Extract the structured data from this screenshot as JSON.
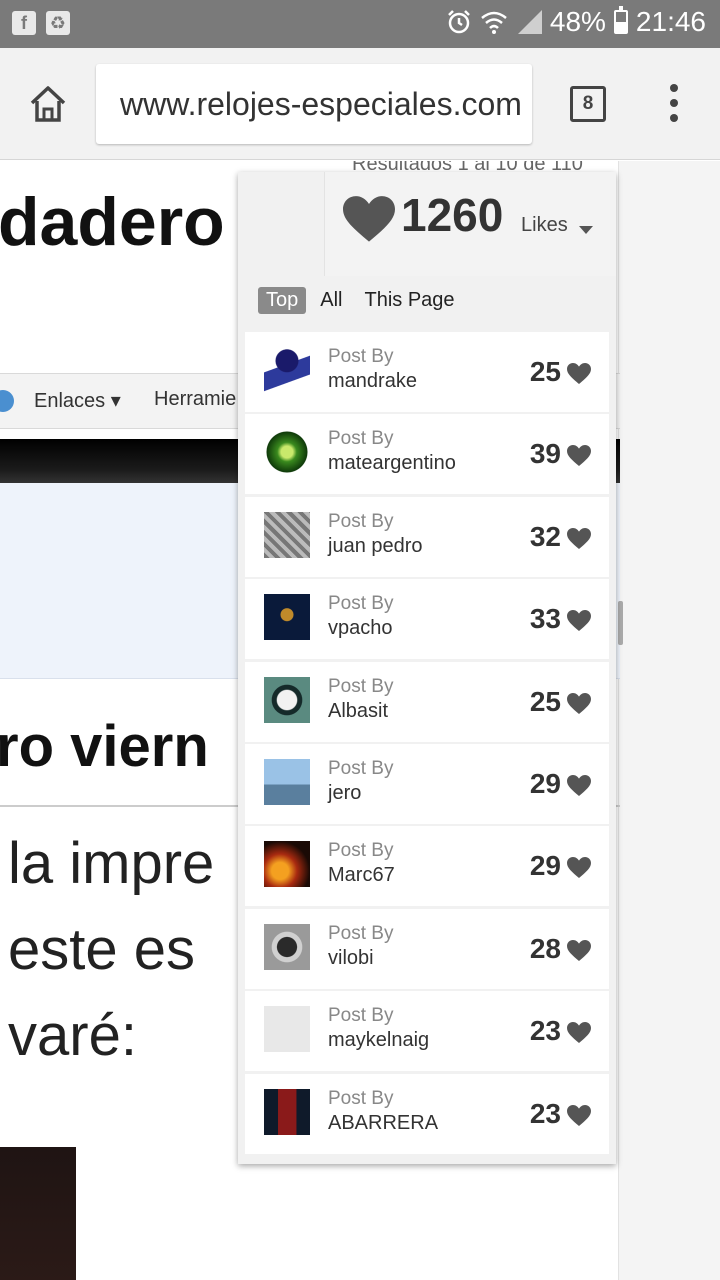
{
  "status_bar": {
    "battery": "48%",
    "battery_level": 0.48,
    "time": "21:46",
    "icons": [
      "facebook-icon",
      "recycle-icon",
      "alarm-icon",
      "wifi-icon",
      "signal-icon",
      "battery-icon"
    ]
  },
  "browser": {
    "url": "www.relojes-especiales.com",
    "tab_count": "8"
  },
  "page": {
    "results_text": "Resultados 1 al 10 de 110",
    "headline_fragment": "dadero",
    "nav_items": [
      "Enlaces",
      "Herramie"
    ],
    "headline2_fragment": "ro viern",
    "body_lines": [
      "la impre",
      "este es",
      "varé:"
    ]
  },
  "likes_widget": {
    "total": "1260",
    "label": "Likes",
    "tabs": [
      "Top",
      "All",
      "This Page"
    ],
    "active_tab": "Top",
    "post_by_label": "Post By",
    "entries": [
      {
        "author": "mandrake",
        "likes": "25"
      },
      {
        "author": "mateargentino",
        "likes": "39"
      },
      {
        "author": "juan pedro",
        "likes": "32"
      },
      {
        "author": "vpacho",
        "likes": "33"
      },
      {
        "author": "Albasit",
        "likes": "25"
      },
      {
        "author": "jero",
        "likes": "29"
      },
      {
        "author": "Marc67",
        "likes": "29"
      },
      {
        "author": "vilobi",
        "likes": "28"
      },
      {
        "author": "maykelnaig",
        "likes": "23"
      },
      {
        "author": "ABARRERA",
        "likes": "23"
      }
    ]
  },
  "colors": {
    "status_bar": "#7a7a7a",
    "toolbar": "#f2f2f2",
    "active_tab": "#8a8a8a",
    "heart": "#555555"
  }
}
